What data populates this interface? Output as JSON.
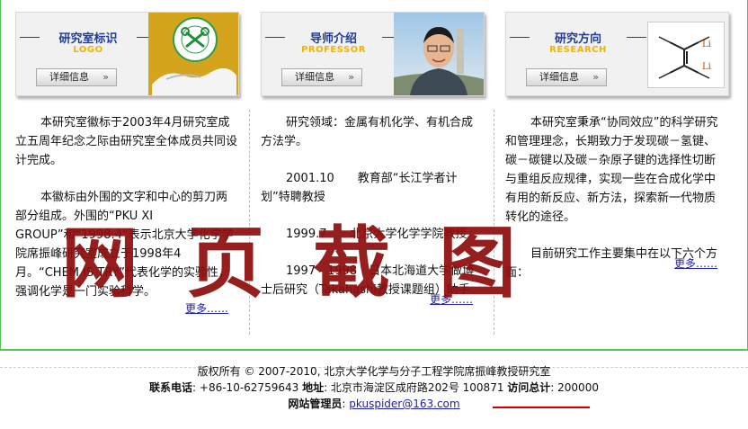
{
  "panels": [
    {
      "title": "研究室标识",
      "subtitle": "LOGO",
      "button": "详细信息",
      "text": [
        "本研究室徽标于2003年4月研究室成立五周年纪念之际由研究室全体成员共同设计完成。",
        "本徽标由外围的文字和中心的剪刀两部分组成。外围的“PKU XI GROUP”和“1998.4”表示北京大学化学学院席振峰研究室成立于1998年4月。“CHEM IS TRY”代表化学的实验性，强调化学是一门实验科学。"
      ],
      "more": "更多……"
    },
    {
      "title": "导师介绍",
      "subtitle": "PROFESSOR",
      "button": "详细信息",
      "text": [
        "研究领域：金属有机化学、有机合成方法学。",
        "2001.10　　教育部“长江学者计划”特聘教授",
        "1999.7　　北京大学化学学院教授",
        "1997 - 1998　日本北海道大学做博士后研究（Takahashi教授课题组）助手"
      ],
      "more": "更多……"
    },
    {
      "title": "研究方向",
      "subtitle": "RESEARCH",
      "button": "详细信息",
      "text": [
        "本研究室秉承“协同效应”的科学研究和管理理念，长期致力于发现碳－氢键、碳－碳键以及碳－杂原子键的选择性切断与重组反应规律，实现一些在合成化学中有用的新反应、新方法，探索新一代物质转化的途径。",
        "目前研究工作主要集中在以下六个方面："
      ],
      "more": "更多……",
      "molecule_label": "Li"
    }
  ],
  "watermark": "网页截图",
  "footer": {
    "copyright": "版权所有 © 2007-2010, 北京大学化学与分子工程学院席振峰教授研究室",
    "phone_label": "联系电话",
    "phone": ": +86-10-62759643 ",
    "address_label": "地址",
    "address": ": 北京市海淀区成府路202号  100871 ",
    "visits_label": "访问总计",
    "visits": ": 200000",
    "admin_label": "网站管理员",
    "admin_sep": ": ",
    "email": "pkuspider@163.com"
  },
  "colors": {
    "title_blue": "#1f3d99",
    "subtitle_gold": "#f0b400",
    "frame_green": "#55c455",
    "watermark_red": "#8e0d0d"
  }
}
